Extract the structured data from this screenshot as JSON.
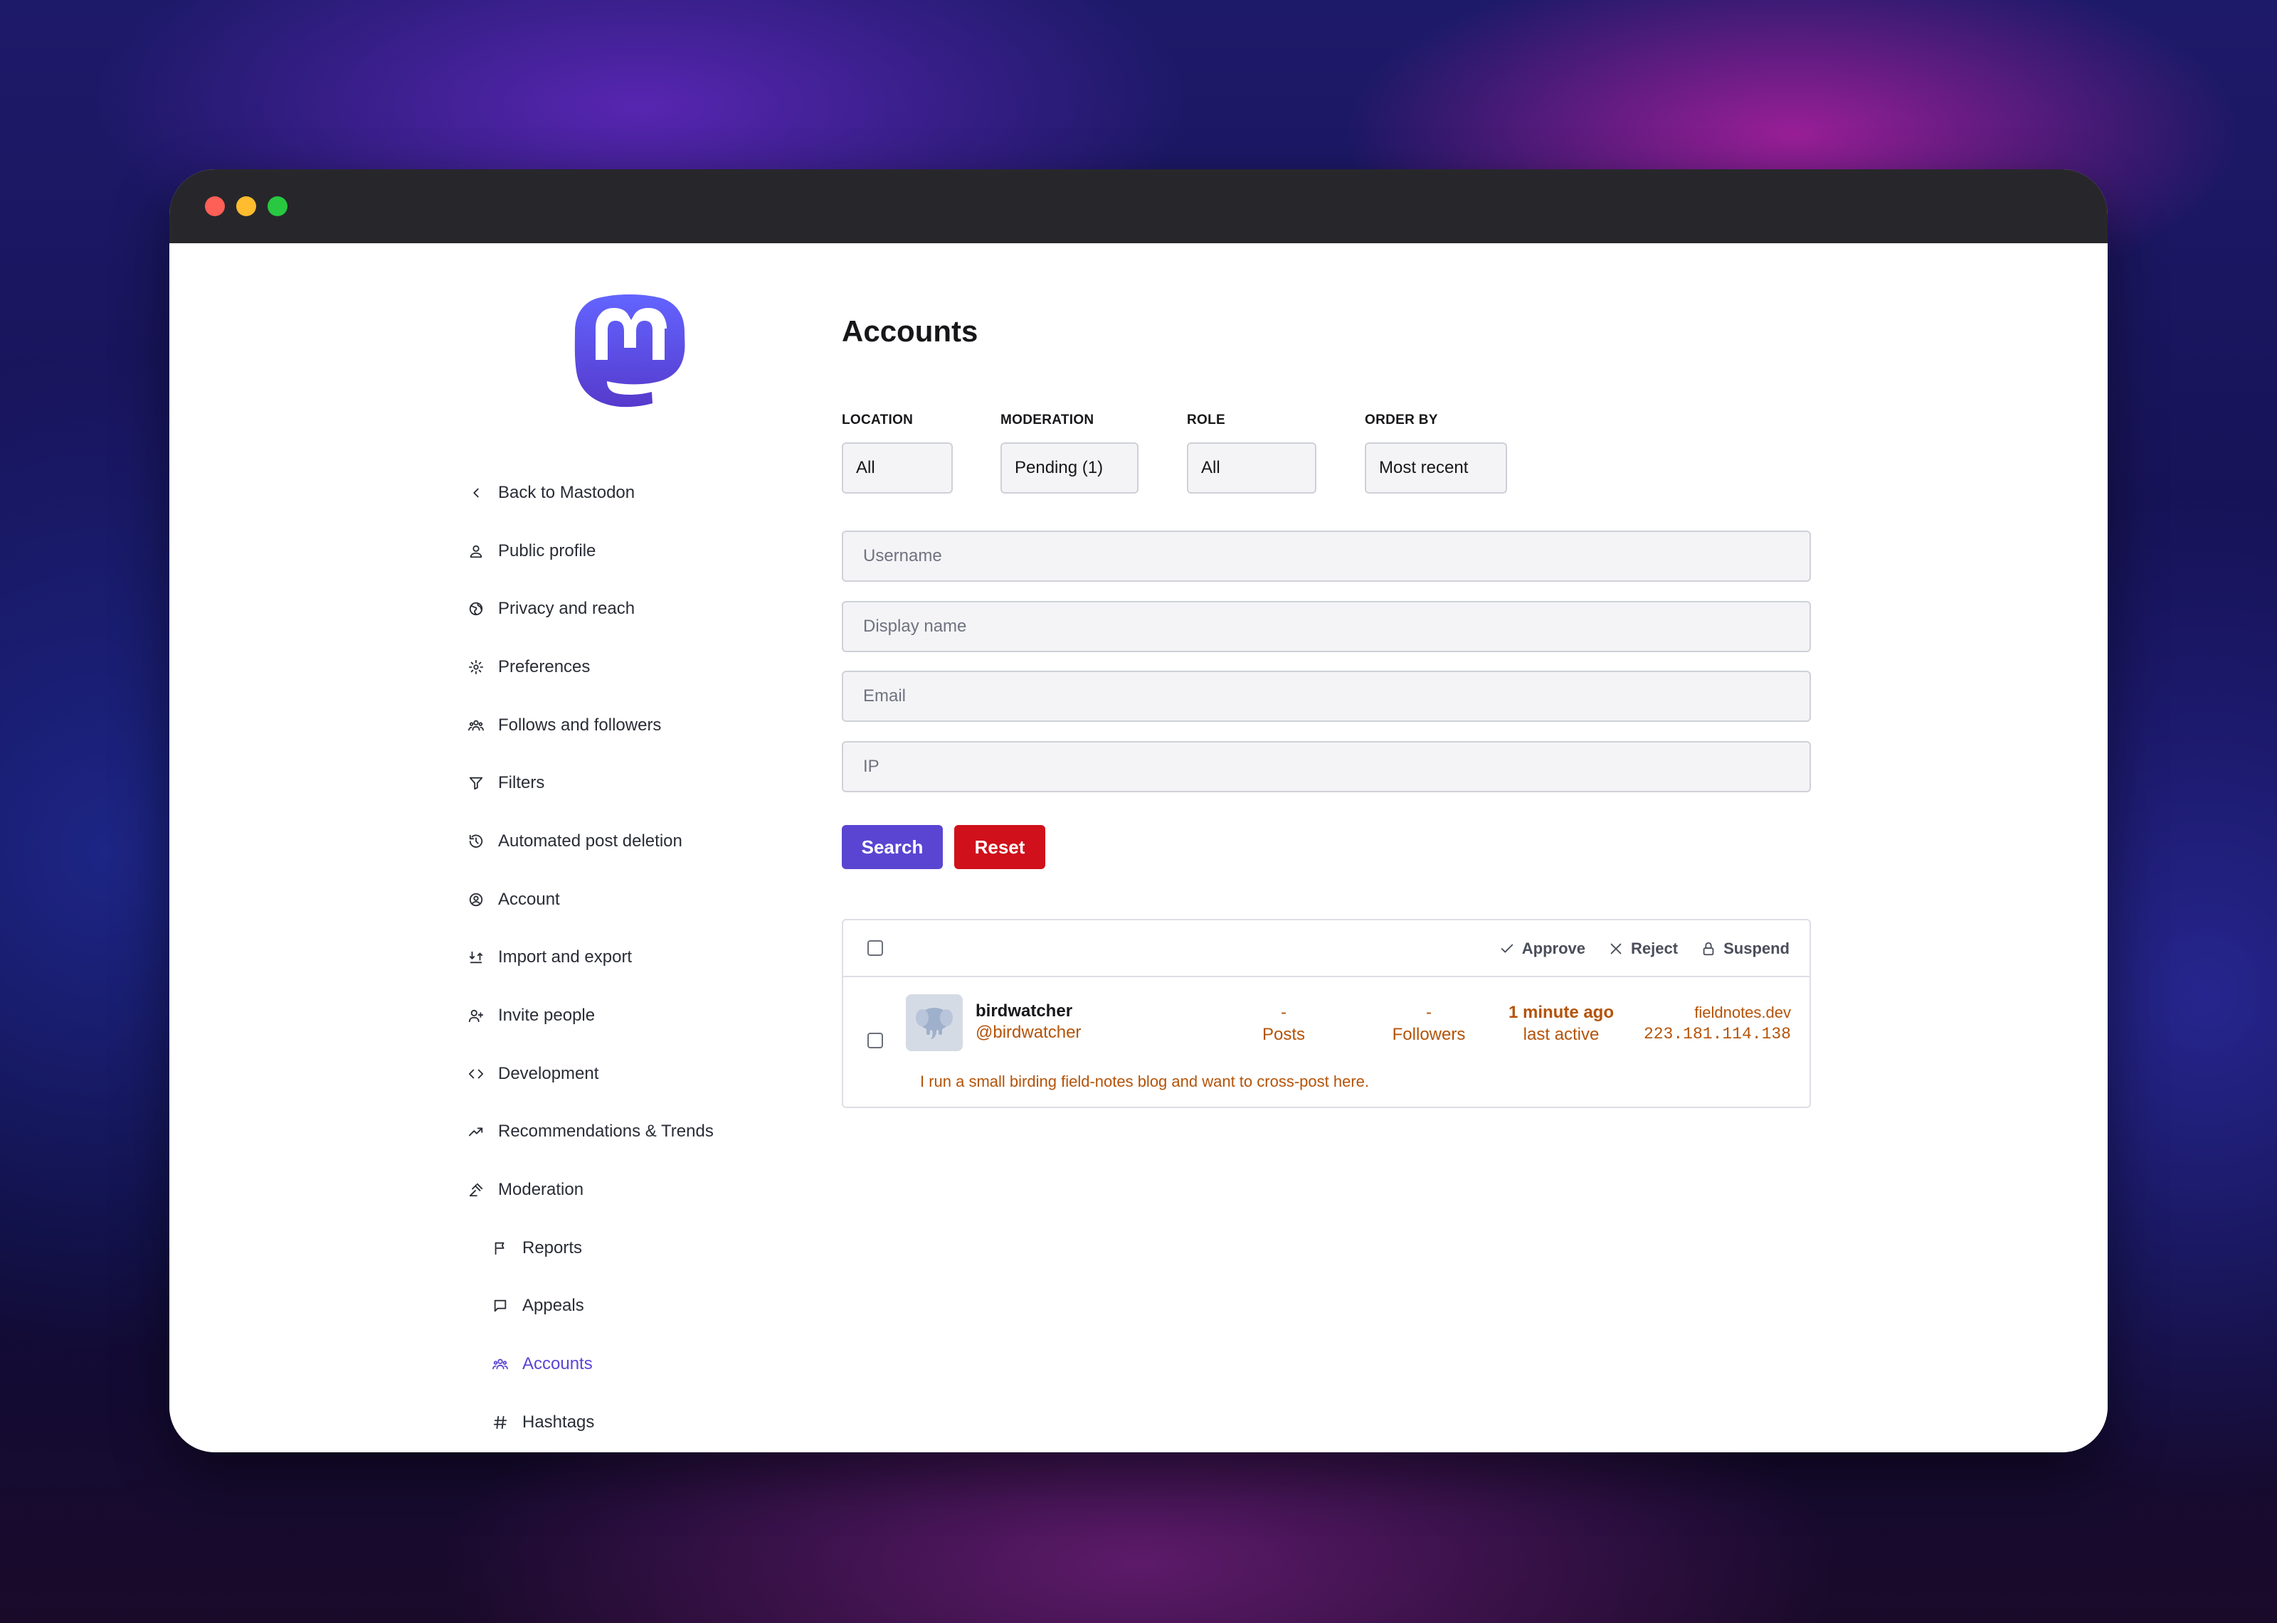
{
  "sidebar": {
    "items": [
      {
        "label": "Back to Mastodon",
        "icon": "chevron-left-icon"
      },
      {
        "label": "Public profile",
        "icon": "person-icon"
      },
      {
        "label": "Privacy and reach",
        "icon": "globe-icon"
      },
      {
        "label": "Preferences",
        "icon": "gear-icon"
      },
      {
        "label": "Follows and followers",
        "icon": "people-icon"
      },
      {
        "label": "Filters",
        "icon": "filter-icon"
      },
      {
        "label": "Automated post deletion",
        "icon": "history-icon"
      },
      {
        "label": "Account",
        "icon": "account-circle-icon"
      },
      {
        "label": "Import and export",
        "icon": "import-export-icon"
      },
      {
        "label": "Invite people",
        "icon": "person-add-icon"
      },
      {
        "label": "Development",
        "icon": "code-icon"
      },
      {
        "label": "Recommendations & Trends",
        "icon": "trending-icon"
      },
      {
        "label": "Moderation",
        "icon": "gavel-icon"
      },
      {
        "label": "Reports",
        "icon": "flag-icon"
      },
      {
        "label": "Appeals",
        "icon": "chat-icon"
      },
      {
        "label": "Accounts",
        "icon": "people-icon"
      },
      {
        "label": "Hashtags",
        "icon": "hashtag-icon"
      }
    ]
  },
  "main": {
    "title": "Accounts",
    "filters": [
      {
        "label": "LOCATION",
        "value": "All"
      },
      {
        "label": "MODERATION",
        "value": "Pending (1)"
      },
      {
        "label": "ROLE",
        "value": "All"
      },
      {
        "label": "ORDER BY",
        "value": "Most recent"
      }
    ],
    "inputs": {
      "username": "Username",
      "display_name": "Display name",
      "email": "Email",
      "ip": "IP"
    },
    "buttons": {
      "search": "Search",
      "reset": "Reset"
    },
    "bulk_actions": {
      "approve": "Approve",
      "reject": "Reject",
      "suspend": "Suspend"
    },
    "accounts": [
      {
        "name": "birdwatcher",
        "handle": "@birdwatcher",
        "posts_value": "-",
        "posts_label": "Posts",
        "followers_value": "-",
        "followers_label": "Followers",
        "last_active_value": "1 minute ago",
        "last_active_label": "last active",
        "domain": "fieldnotes.dev",
        "ip": "223.181.114.138",
        "reason": "I run a small birding field-notes blog and want to cross-post here."
      }
    ]
  },
  "colors": {
    "accent": "#5a45d2",
    "danger": "#d0101a",
    "pending": "#b45309",
    "active_nav": "#5b45d6"
  }
}
